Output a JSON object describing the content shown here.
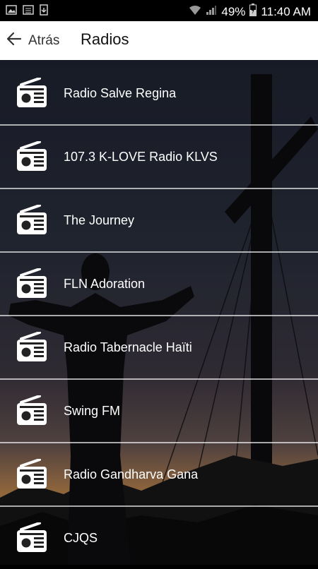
{
  "status_bar": {
    "battery": "49%",
    "time": "11:40 AM"
  },
  "header": {
    "back_label": "Atrás",
    "title": "Radios"
  },
  "stations": [
    {
      "name": "Radio Salve Regina"
    },
    {
      "name": "107.3 K-LOVE Radio KLVS"
    },
    {
      "name": "The Journey"
    },
    {
      "name": "FLN Adoration"
    },
    {
      "name": "Radio Tabernacle Haïti"
    },
    {
      "name": "Swing FM"
    },
    {
      "name": "Radio Gandharva Gana"
    },
    {
      "name": "CJQS"
    }
  ],
  "icons": {
    "row": "radio-icon",
    "back": "arrow-left-icon"
  }
}
